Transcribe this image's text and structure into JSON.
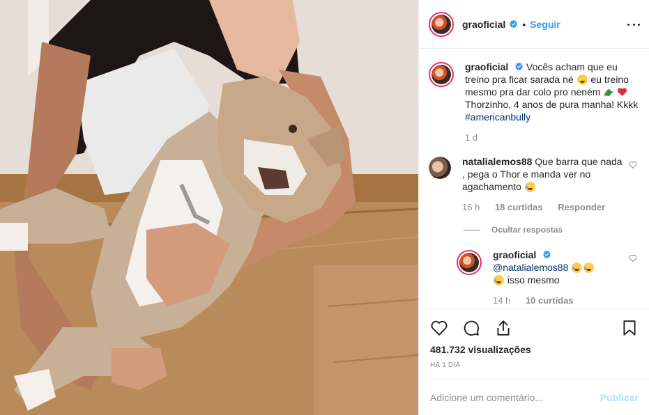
{
  "post": {
    "media_description_icon": "photo-dog-and-woman",
    "author": {
      "username": "graoficial",
      "verified": true,
      "follow_label": "Seguir"
    },
    "caption": {
      "text_1": "Vocês acham que eu treino pra ficar sarada né",
      "text_2": "eu treino mesmo pra dar colo pro neném",
      "text_3": "Thorzinho, 4 anos de pura manha! Kkkk",
      "hashtag": "#americanbully",
      "time": "1 d"
    },
    "comments": [
      {
        "username": "natalialemos88",
        "text": "Que barra que nada , pega o Thor e manda ver no agachamento",
        "time": "16 h",
        "likes": "18 curtidas",
        "reply_label": "Responder",
        "hide_replies_label": "Ocultar respostas",
        "replies": [
          {
            "username": "graoficial",
            "mention": "@natalialemos88",
            "text": "isso mesmo",
            "time": "14 h",
            "likes": "10 curtidas"
          }
        ]
      }
    ],
    "stats": {
      "views": "481.732 visualizações",
      "posted_ago": "Há 1 dia"
    },
    "add_comment": {
      "placeholder": "Adicione um comentário...",
      "publish_label": "Publicar"
    }
  },
  "colors": {
    "link_blue": "#3897f0",
    "publish_disabled": "#b2dffc",
    "muted": "#8e8e8e",
    "text": "#262626",
    "border": "#efefef"
  }
}
